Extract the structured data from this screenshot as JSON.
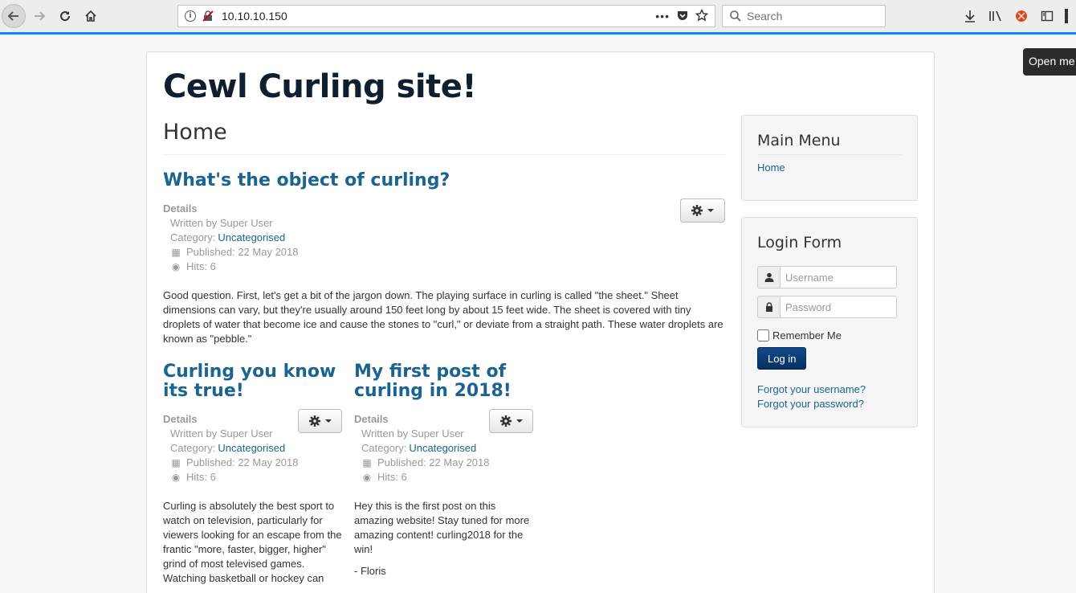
{
  "browser": {
    "url": "10.10.10.150",
    "search_placeholder": "Search",
    "tooltip": "Open me"
  },
  "site": {
    "title": "Cewl Curling site!",
    "page_heading": "Home"
  },
  "articles": [
    {
      "title": "What's the object of curling?",
      "details_label": "Details",
      "written_by": "Written by Super User",
      "category_label": "Category:",
      "category": "Uncategorised",
      "published": "Published: 22 May 2018",
      "hits": "Hits: 6",
      "body": "Good question. First, let's get a bit of the jargon down. The playing surface in curling is called \"the sheet.\" Sheet dimensions can vary, but they're usually around 150 feet long by about 15 feet wide. The sheet is covered with tiny droplets of water that become ice and cause the stones to \"curl,\" or deviate from a straight path. These water droplets are known as \"pebble.\""
    },
    {
      "title": "Curling you know its true!",
      "details_label": "Details",
      "written_by": "Written by Super User",
      "category_label": "Category:",
      "category": "Uncategorised",
      "published": "Published: 22 May 2018",
      "hits": "Hits: 6",
      "body": "Curling is absolutely the best sport to watch on television, particularly for viewers looking for an escape from the frantic \"more, faster, bigger, higher\" grind of most televised games. Watching basketball or hockey can"
    },
    {
      "title": "My first post of curling in 2018!",
      "details_label": "Details",
      "written_by": "Written by Super User",
      "category_label": "Category:",
      "category": "Uncategorised",
      "published": "Published: 22 May 2018",
      "hits": "Hits: 6",
      "body": "Hey this is the first post on this amazing website! Stay tuned for more amazing content! curling2018 for the win!",
      "signature": "- Floris"
    }
  ],
  "sidebar": {
    "main_menu": {
      "title": "Main Menu",
      "items": [
        "Home"
      ]
    },
    "login": {
      "title": "Login Form",
      "username_placeholder": "Username",
      "password_placeholder": "Password",
      "remember_label": "Remember Me",
      "login_button": "Log in",
      "forgot_username": "Forgot your username?",
      "forgot_password": "Forgot your password?"
    }
  },
  "colors": {
    "accent": "#0a84ff",
    "link": "#1a6491",
    "login_button": "#0b3d76"
  }
}
